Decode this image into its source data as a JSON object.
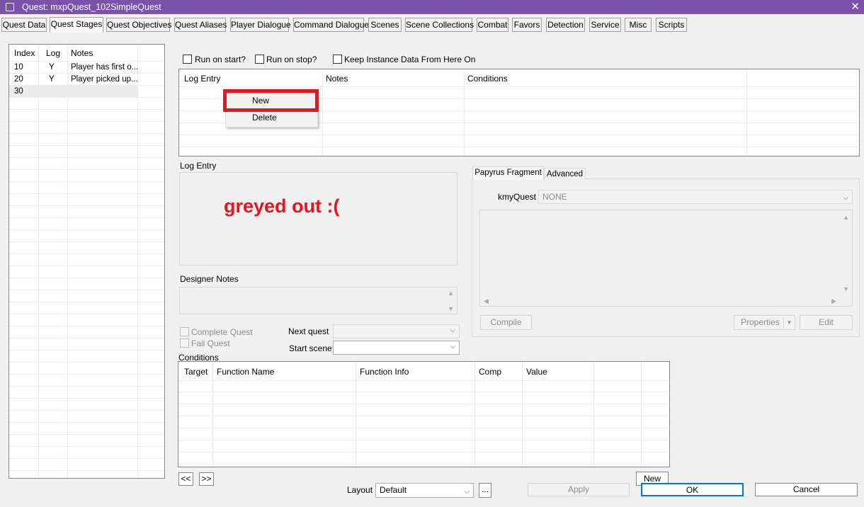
{
  "window": {
    "title": "Quest: mxpQuest_102SimpleQuest",
    "close_glyph": "✕"
  },
  "tabs": [
    {
      "label": "Quest Data"
    },
    {
      "label": "Quest Stages"
    },
    {
      "label": "Quest Objectives"
    },
    {
      "label": "Quest Aliases"
    },
    {
      "label": "Player Dialogue"
    },
    {
      "label": "Command Dialogue"
    },
    {
      "label": "Scenes"
    },
    {
      "label": "Scene Collections"
    },
    {
      "label": "Combat"
    },
    {
      "label": "Favors"
    },
    {
      "label": "Detection"
    },
    {
      "label": "Service"
    },
    {
      "label": "Misc"
    },
    {
      "label": "Scripts"
    }
  ],
  "active_tab": "Quest Stages",
  "stages": {
    "columns": [
      "Index",
      "Log",
      "Notes"
    ],
    "rows": [
      {
        "index": "10",
        "log": "Y",
        "notes": "Player has first o..."
      },
      {
        "index": "20",
        "log": "Y",
        "notes": "Player picked up..."
      },
      {
        "index": "30",
        "log": "",
        "notes": ""
      }
    ]
  },
  "stage_options": {
    "run_on_start": "Run on start?",
    "run_on_stop": "Run on stop?",
    "keep_instance": "Keep Instance Data From Here On"
  },
  "log_entries": {
    "columns": [
      "Log Entry",
      "Notes",
      "Conditions"
    ]
  },
  "context_menu": {
    "new": "New",
    "delete": "Delete"
  },
  "log_entry": {
    "label": "Log Entry",
    "annotation": "greyed out :("
  },
  "designer_notes": {
    "label": "Designer Notes"
  },
  "quest_flags": {
    "complete": "Complete Quest",
    "fail": "Fail Quest"
  },
  "next_quest": {
    "label": "Next quest",
    "value": ""
  },
  "start_scene": {
    "label": "Start scene",
    "value": ""
  },
  "conditions": {
    "label": "Conditions",
    "columns": [
      "Target",
      "Function Name",
      "Function Info",
      "Comp",
      "Value"
    ]
  },
  "papyrus": {
    "tabs": [
      "Papyrus Fragment",
      "Advanced"
    ],
    "kmy_label": "kmyQuest",
    "kmy_value": "NONE",
    "compile": "Compile",
    "properties": "Properties",
    "edit": "Edit"
  },
  "nav": {
    "prev": "<<",
    "next": ">>"
  },
  "new_button": "New",
  "layout": {
    "label": "Layout",
    "value": "Default",
    "more": "..."
  },
  "footer": {
    "apply": "Apply",
    "ok": "OK",
    "cancel": "Cancel"
  },
  "colors": {
    "titlebar": "#7a52a8",
    "annotation": "#e8161c",
    "highlight": "#e8161c"
  }
}
